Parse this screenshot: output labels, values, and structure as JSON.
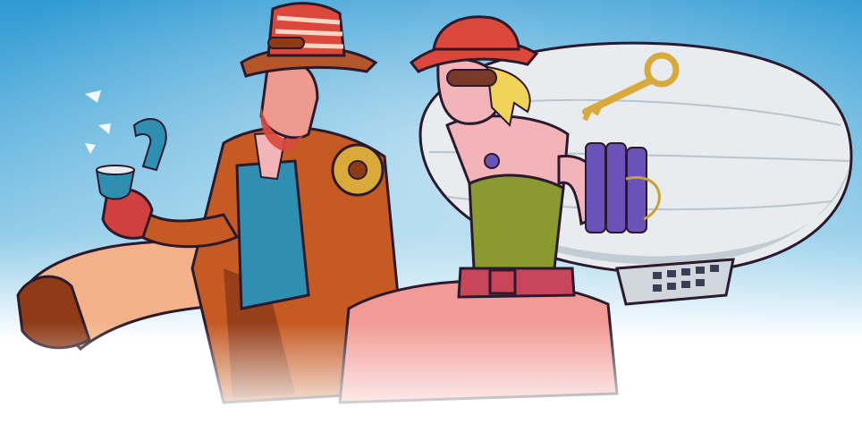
{
  "scene": {
    "kind": "illustration",
    "style": "steampunk-cartoon",
    "subjects": [
      "gentleman-adventurer",
      "lady-adventurer",
      "airship"
    ],
    "palette": {
      "sky_top": "#2f9ad3",
      "sky_mid": "#8fcbe8",
      "sky_fade": "#ffffff",
      "ink": "#2b1a2e",
      "coat": "#c55a22",
      "coat_shade": "#8e3b16",
      "vest": "#2f8fb0",
      "hat_brown": "#b5562a",
      "hat_red": "#d9483a",
      "skin_m": "#ef9a8e",
      "skin_f": "#f2b4b8",
      "corset": "#8a9a2e",
      "skirt": "#f29a95",
      "belt": "#c8455a",
      "airship": "#e8ecef",
      "airship_shade": "#b9c4cc",
      "gondola": "#cfd6dc",
      "key": "#d9a93a",
      "dynamite": "#6b52b8",
      "glove": "#d0403f",
      "pants": "#f3b28a",
      "hair_f": "#f2d35a"
    }
  }
}
